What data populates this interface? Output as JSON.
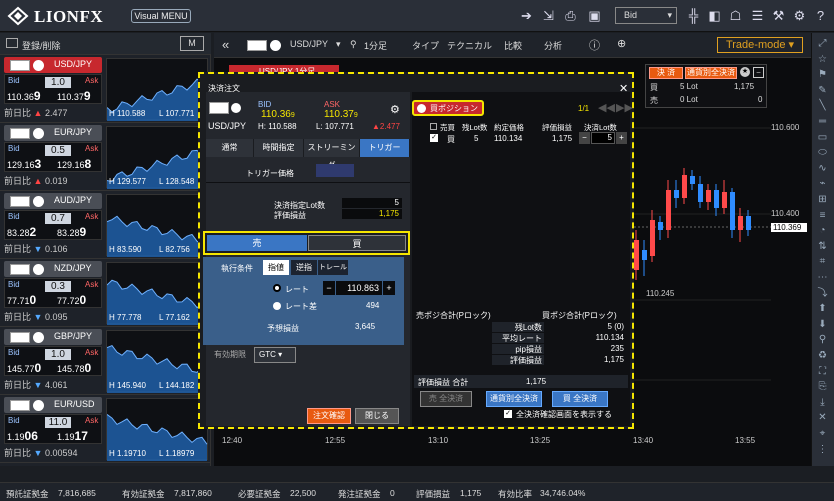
{
  "app": {
    "logo_text": "LIONFX",
    "menu_label": "Visual MENU",
    "price_mode": "Bid"
  },
  "left_panel": {
    "header_label": "登録/削除",
    "header_btn": "M",
    "pairs": [
      {
        "name": "USD/JPY",
        "active": true,
        "spread": "1.0",
        "bid_pre": "110.36",
        "bid_last": "9",
        "ask_pre": "110.37",
        "ask_last": "9",
        "change_label": "前日比",
        "change": "2.477",
        "dir": "up",
        "high": "110.588",
        "low": "107.771"
      },
      {
        "name": "EUR/JPY",
        "active": false,
        "spread": "0.5",
        "bid_pre": "129.16",
        "bid_last": "3",
        "ask_pre": "129.16",
        "ask_last": "8",
        "change_label": "前日比",
        "change": "0.019",
        "dir": "up",
        "high": "129.577",
        "low": "128.548"
      },
      {
        "name": "AUD/JPY",
        "active": false,
        "spread": "0.7",
        "bid_pre": "83.28",
        "bid_last": "2",
        "ask_pre": "83.28",
        "ask_last": "9",
        "change_label": "前日比",
        "change": "0.106",
        "dir": "down",
        "high": "83.590",
        "low": "82.756"
      },
      {
        "name": "NZD/JPY",
        "active": false,
        "spread": "0.3",
        "bid_pre": "77.71",
        "bid_last": "0",
        "ask_pre": "77.72",
        "ask_last": "0",
        "change_label": "前日比",
        "change": "0.095",
        "dir": "down",
        "high": "77.778",
        "low": "77.162"
      },
      {
        "name": "GBP/JPY",
        "active": false,
        "spread": "1.0",
        "bid_pre": "145.77",
        "bid_last": "0",
        "ask_pre": "145.78",
        "ask_last": "0",
        "change_label": "前日比",
        "change": "4.061",
        "dir": "down",
        "high": "145.940",
        "low": "144.182"
      },
      {
        "name": "EUR/USD",
        "active": false,
        "spread": "11.0",
        "bid_pre": "1.19",
        "bid_last": "06",
        "ask_pre": "1.19",
        "ask_last": "17",
        "change_label": "前日比",
        "change": "0.00594",
        "dir": "down",
        "high": "1.19710",
        "low": "1.18979"
      }
    ]
  },
  "chart": {
    "pair": "USD/JPY",
    "interval": "1分足",
    "menu": [
      "タイプ",
      "テクニカル",
      "比較",
      "分析"
    ],
    "trade_mode": "Trade-mode",
    "tab_label": "USD/JPY 1分足",
    "y_labels": [
      "110.600",
      "110.400",
      "110.369",
      "110.245"
    ],
    "x_labels": [
      "12:40",
      "12:55",
      "13:10",
      "13:25",
      "13:40",
      "13:55"
    ]
  },
  "summary_box": {
    "settle_label": "決 済",
    "by_lot_label": "通貨別全決済",
    "buy_label": "買",
    "buy_lot": "5 Lot",
    "buy_value": "1,175",
    "sell_label": "売",
    "sell_lot": "0 Lot",
    "sell_value": "0"
  },
  "dialog": {
    "title": "決済注文",
    "pair": "USD/JPY",
    "bid_label": "BID",
    "ask_label": "ASK",
    "bid_pre": "110.36",
    "bid_last": "9",
    "ask_pre": "110.37",
    "ask_last": "9",
    "high": "H: 110.588",
    "low": "L: 107.771",
    "change": "▲2.477",
    "tabs": [
      "通常",
      "時間指定",
      "ストリーミング",
      "トリガー"
    ],
    "trigger_label": "トリガー価格",
    "settle_lot_label": "決済指定Lot数",
    "settle_lot": "5",
    "pl_label": "評価損益",
    "pl": "1,175",
    "sell": "売",
    "buy": "買",
    "exec_label": "執行条件",
    "exec_opts": [
      "指値",
      "逆指",
      "トレール"
    ],
    "rate_label": "レート",
    "rate_value": "110.863",
    "rate_diff_label": "レート差",
    "rate_diff": "494",
    "expected_pl_label": "予想損益",
    "expected_pl": "3,645",
    "expiry_label": "有効期限",
    "expiry_value": "GTC",
    "confirm_btn": "注文確認",
    "close_btn": "閉じる",
    "position_toggle": "買ポジション",
    "page": "1/1",
    "table_headers": [
      "売買",
      "残Lot数",
      "約定価格",
      "評価損益",
      "決済Lot数"
    ],
    "row": {
      "side": "買",
      "lots": "5",
      "price": "110.134",
      "pl": "1,175",
      "settle": "5"
    },
    "sell_total_label": "売ポジ合計(Pロック)",
    "buy_total_label": "買ポジ合計(Pロック)",
    "summary_rows": [
      {
        "label": "残Lot数",
        "value": "5 (0)"
      },
      {
        "label": "平均レート",
        "value": "110.134"
      },
      {
        "label": "pip損益",
        "value": "235"
      },
      {
        "label": "評価損益",
        "value": "1,175"
      }
    ],
    "total_pl_label": "評価損益 合計",
    "total_pl": "1,175",
    "btn_sell_all": "売 全決済",
    "btn_by_currency": "通貨別全決済",
    "btn_buy_all": "買 全決済",
    "confirm_check": "全決済確認画面を表示する"
  },
  "status": [
    {
      "label": "預託証拠金",
      "value": "7,816,685"
    },
    {
      "label": "有効証拠金",
      "value": "7,817,860"
    },
    {
      "label": "必要証拠金",
      "value": "22,500"
    },
    {
      "label": "発注証拠金",
      "value": "0"
    },
    {
      "label": "評価損益",
      "value": "1,175"
    },
    {
      "label": "有効比率",
      "value": "34,746.04%"
    }
  ]
}
